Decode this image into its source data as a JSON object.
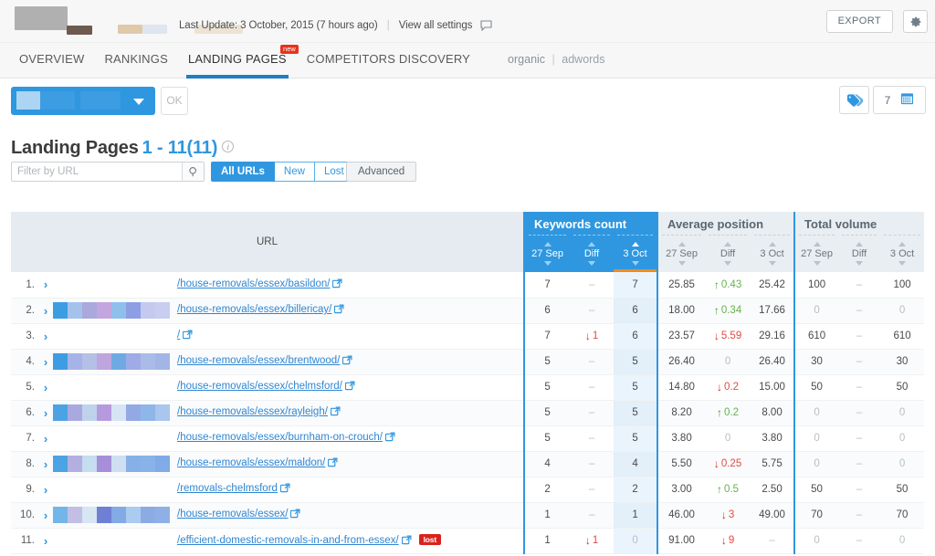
{
  "topbar": {
    "last_update": "Last Update: 3 October, 2015 (7 hours ago)",
    "view_all_settings": "View all settings",
    "export_label": "EXPORT",
    "gear_icon": "gear-icon",
    "speech_icon": "speech-bubble-icon"
  },
  "nav": {
    "tabs": [
      {
        "label": "OVERVIEW",
        "active": false
      },
      {
        "label": "RANKINGS",
        "active": false
      },
      {
        "label": "LANDING PAGES",
        "active": true,
        "badge": "new"
      },
      {
        "label": "COMPETITORS DISCOVERY",
        "active": false
      }
    ],
    "mode_organic": "organic",
    "mode_sep": "|",
    "mode_adwords": "adwords"
  },
  "filters": {
    "dropdown_caret": "chevron-down-icon",
    "ok_label": "OK",
    "tag_icon": "tags-icon",
    "date_count": "7",
    "calendar_icon": "calendar-icon"
  },
  "title": {
    "heading": "Landing Pages",
    "range": "1 - 11(11)",
    "info_icon": "info-icon"
  },
  "search": {
    "placeholder": "Filter by URL",
    "value": "",
    "search_icon": "search-icon"
  },
  "segments": [
    {
      "label": "All URLs",
      "active": true
    },
    {
      "label": "New",
      "active": false
    },
    {
      "label": "Lost",
      "active": false
    }
  ],
  "advanced_label": "Advanced",
  "table": {
    "url_header": "URL",
    "groups": [
      {
        "key": "keywords_count",
        "label": "Keywords count",
        "accent": "#2f97e0",
        "highlight": true
      },
      {
        "key": "average_position",
        "label": "Average position",
        "accent": "#e9eef2",
        "highlight": false
      },
      {
        "key": "total_volume",
        "label": "Total volume",
        "accent": "#e9eef2",
        "highlight": false
      }
    ],
    "sub_headers": [
      "27 Sep",
      "Diff",
      "3 Oct"
    ],
    "sorted_group": "keywords_count",
    "sorted_column": "3 Oct",
    "sorted_direction": "asc",
    "rows": [
      {
        "index": "1.",
        "url": "/house-removals/essex/basildon/",
        "bars": [],
        "lost": false,
        "kw": {
          "prev": "7",
          "diff": "",
          "diff_dir": "none",
          "cur": "7",
          "cur_zero": false
        },
        "pos": {
          "prev": "25.85",
          "diff": "0.43",
          "diff_dir": "up",
          "cur": "25.42"
        },
        "vol": {
          "prev": "100",
          "prev_zero": false,
          "diff": "",
          "diff_dir": "none",
          "cur": "100",
          "cur_zero": false
        }
      },
      {
        "index": "2.",
        "url": "/house-removals/essex/billericay/",
        "bars": [
          "#3d9de2",
          "#a4c2ec",
          "#aba8de",
          "#c3a6df",
          "#8fc0ec",
          "#8e9ee4",
          "#c3c9ef",
          "#c9cdf0"
        ],
        "lost": false,
        "kw": {
          "prev": "6",
          "diff": "",
          "diff_dir": "none",
          "cur": "6",
          "cur_zero": false
        },
        "pos": {
          "prev": "18.00",
          "diff": "0.34",
          "diff_dir": "up",
          "cur": "17.66"
        },
        "vol": {
          "prev": "0",
          "prev_zero": true,
          "diff": "",
          "diff_dir": "none",
          "cur": "0",
          "cur_zero": true
        }
      },
      {
        "index": "3.",
        "url": "/",
        "bars": [],
        "lost": false,
        "kw": {
          "prev": "7",
          "diff": "1",
          "diff_dir": "down",
          "cur": "6",
          "cur_zero": false
        },
        "pos": {
          "prev": "23.57",
          "diff": "5.59",
          "diff_dir": "down",
          "cur": "29.16"
        },
        "vol": {
          "prev": "610",
          "prev_zero": false,
          "diff": "",
          "diff_dir": "none",
          "cur": "610",
          "cur_zero": false
        }
      },
      {
        "index": "4.",
        "url": "/house-removals/essex/brentwood/",
        "bars": [
          "#3d9de2",
          "#a6b3e8",
          "#b4c0e5",
          "#bfa4dd",
          "#6fa9e4",
          "#9fabe6",
          "#a9bce8",
          "#a2b5e6"
        ],
        "lost": false,
        "kw": {
          "prev": "5",
          "diff": "",
          "diff_dir": "none",
          "cur": "5",
          "cur_zero": false
        },
        "pos": {
          "prev": "26.40",
          "diff": "0",
          "diff_dir": "zero",
          "cur": "26.40"
        },
        "vol": {
          "prev": "30",
          "prev_zero": false,
          "diff": "",
          "diff_dir": "none",
          "cur": "30",
          "cur_zero": false
        }
      },
      {
        "index": "5.",
        "url": "/house-removals/essex/chelmsford/",
        "bars": [],
        "lost": false,
        "kw": {
          "prev": "5",
          "diff": "",
          "diff_dir": "none",
          "cur": "5",
          "cur_zero": false
        },
        "pos": {
          "prev": "14.80",
          "diff": "0.2",
          "diff_dir": "down",
          "cur": "15.00"
        },
        "vol": {
          "prev": "50",
          "prev_zero": false,
          "diff": "",
          "diff_dir": "none",
          "cur": "50",
          "cur_zero": false
        }
      },
      {
        "index": "6.",
        "url": "/house-removals/essex/rayleigh/",
        "bars": [
          "#4ba3e4",
          "#a9a9e0",
          "#bfd2ec",
          "#b69ade",
          "#d7e4f4",
          "#93a9e6",
          "#8fb6e8",
          "#a8c6ee"
        ],
        "lost": false,
        "kw": {
          "prev": "5",
          "diff": "",
          "diff_dir": "none",
          "cur": "5",
          "cur_zero": false
        },
        "pos": {
          "prev": "8.20",
          "diff": "0.2",
          "diff_dir": "up",
          "cur": "8.00"
        },
        "vol": {
          "prev": "0",
          "prev_zero": true,
          "diff": "",
          "diff_dir": "none",
          "cur": "0",
          "cur_zero": true
        }
      },
      {
        "index": "7.",
        "url": "/house-removals/essex/burnham-on-crouch/",
        "bars": [],
        "lost": false,
        "kw": {
          "prev": "5",
          "diff": "",
          "diff_dir": "none",
          "cur": "5",
          "cur_zero": false
        },
        "pos": {
          "prev": "3.80",
          "diff": "0",
          "diff_dir": "zero",
          "cur": "3.80"
        },
        "vol": {
          "prev": "0",
          "prev_zero": true,
          "diff": "",
          "diff_dir": "none",
          "cur": "0",
          "cur_zero": true
        }
      },
      {
        "index": "8.",
        "url": "/house-removals/essex/maldon/",
        "bars": [
          "#4ba3e4",
          "#b3afe0",
          "#c6dcef",
          "#a78ed8",
          "#cfdff1",
          "#87b0e8",
          "#88b2e8",
          "#7fabe6"
        ],
        "lost": false,
        "kw": {
          "prev": "4",
          "diff": "",
          "diff_dir": "none",
          "cur": "4",
          "cur_zero": false
        },
        "pos": {
          "prev": "5.50",
          "diff": "0.25",
          "diff_dir": "down",
          "cur": "5.75"
        },
        "vol": {
          "prev": "0",
          "prev_zero": true,
          "diff": "",
          "diff_dir": "none",
          "cur": "0",
          "cur_zero": true
        }
      },
      {
        "index": "9.",
        "url": "/removals-chelmsford",
        "bars": [],
        "lost": false,
        "kw": {
          "prev": "2",
          "diff": "",
          "diff_dir": "none",
          "cur": "2",
          "cur_zero": false
        },
        "pos": {
          "prev": "3.00",
          "diff": "0.5",
          "diff_dir": "up",
          "cur": "2.50"
        },
        "vol": {
          "prev": "50",
          "prev_zero": false,
          "diff": "",
          "diff_dir": "none",
          "cur": "50",
          "cur_zero": false
        }
      },
      {
        "index": "10.",
        "url": "/house-removals/essex/",
        "bars": [
          "#72b5e8",
          "#c3bee4",
          "#d6e6f3",
          "#6f7fd4",
          "#82aae4",
          "#abcbf0",
          "#8aabe4",
          "#8fb0e6"
        ],
        "lost": false,
        "kw": {
          "prev": "1",
          "diff": "",
          "diff_dir": "none",
          "cur": "1",
          "cur_zero": false
        },
        "pos": {
          "prev": "46.00",
          "diff": "3",
          "diff_dir": "down",
          "cur": "49.00"
        },
        "vol": {
          "prev": "70",
          "prev_zero": false,
          "diff": "",
          "diff_dir": "none",
          "cur": "70",
          "cur_zero": false
        }
      },
      {
        "index": "11.",
        "url": "/efficient-domestic-removals-in-and-from-essex/",
        "bars": [],
        "lost": true,
        "lost_label": "lost",
        "kw": {
          "prev": "1",
          "diff": "1",
          "diff_dir": "down",
          "cur": "0",
          "cur_zero": true
        },
        "pos": {
          "prev": "91.00",
          "diff": "9",
          "diff_dir": "down",
          "cur": ""
        },
        "vol": {
          "prev": "0",
          "prev_zero": true,
          "diff": "",
          "diff_dir": "none",
          "cur": "0",
          "cur_zero": true
        }
      }
    ]
  },
  "colors": {
    "accent_blue": "#2f97e0",
    "link_blue": "#2f86d2",
    "sort_orange": "#f08b1d",
    "up_green": "#63b44c",
    "down_red": "#e04b44",
    "lost_red": "#d8231c",
    "badge_red": "#e8341c"
  }
}
